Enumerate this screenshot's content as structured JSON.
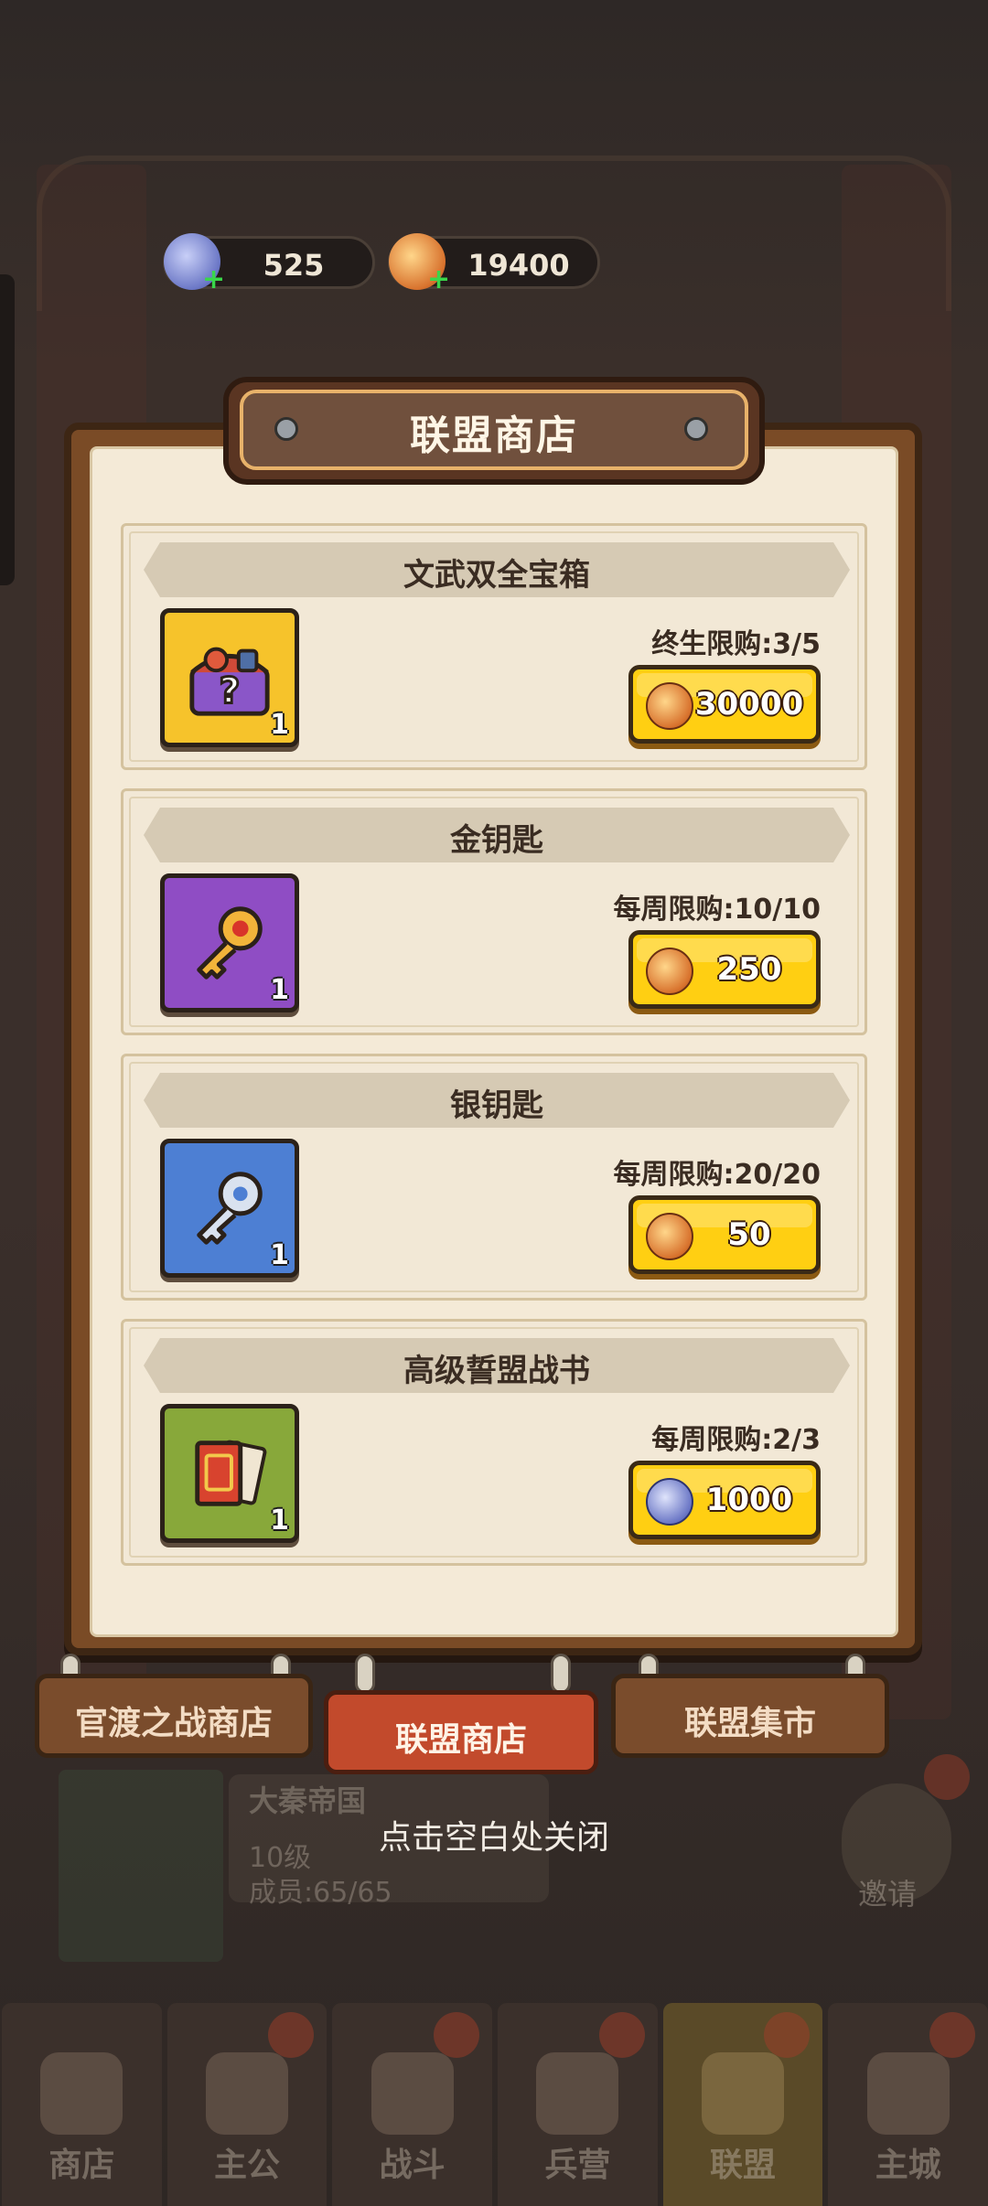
{
  "currency": {
    "gem": {
      "icon": "dragon-gem-icon",
      "value": "525"
    },
    "gold": {
      "icon": "dragon-coin-icon",
      "value": "19400"
    }
  },
  "modal": {
    "title": "联盟商店",
    "items": [
      {
        "name": "文武双全宝箱",
        "icon": "mystery-chest-icon",
        "quantity": "1",
        "limit": "终生限购:3/5",
        "price": "30000",
        "currency_icon": "dragon-coin-icon"
      },
      {
        "name": "金钥匙",
        "icon": "gold-key-icon",
        "quantity": "1",
        "limit": "每周限购:10/10",
        "price": "250",
        "currency_icon": "dragon-coin-icon"
      },
      {
        "name": "银钥匙",
        "icon": "silver-key-icon",
        "quantity": "1",
        "limit": "每周限购:20/20",
        "price": "50",
        "currency_icon": "dragon-coin-icon"
      },
      {
        "name": "高级誓盟战书",
        "icon": "oath-scroll-icon",
        "quantity": "1",
        "limit": "每周限购:2/3",
        "price": "1000",
        "currency_icon": "dragon-gem-icon"
      }
    ]
  },
  "tabs": [
    {
      "label": "官渡之战商店",
      "active": false
    },
    {
      "label": "联盟商店",
      "active": true
    },
    {
      "label": "联盟集市",
      "active": false
    }
  ],
  "close_hint": "点击空白处关闭",
  "background": {
    "guild_name": "大秦帝国",
    "guild_level": "10级",
    "guild_members": "成员:65/65",
    "invite_label": "邀请"
  },
  "bottom_nav": [
    {
      "label": "商店",
      "alert": false
    },
    {
      "label": "主公",
      "alert": true
    },
    {
      "label": "战斗",
      "alert": true
    },
    {
      "label": "兵营",
      "alert": true
    },
    {
      "label": "联盟",
      "alert": true,
      "active": true
    },
    {
      "label": "主城",
      "alert": true
    }
  ],
  "colors": {
    "button_yellow": "#ffcf12",
    "active_tab_red": "#c24a2c",
    "paper": "#f4ead7",
    "frame_wood": "#7a4b26"
  }
}
